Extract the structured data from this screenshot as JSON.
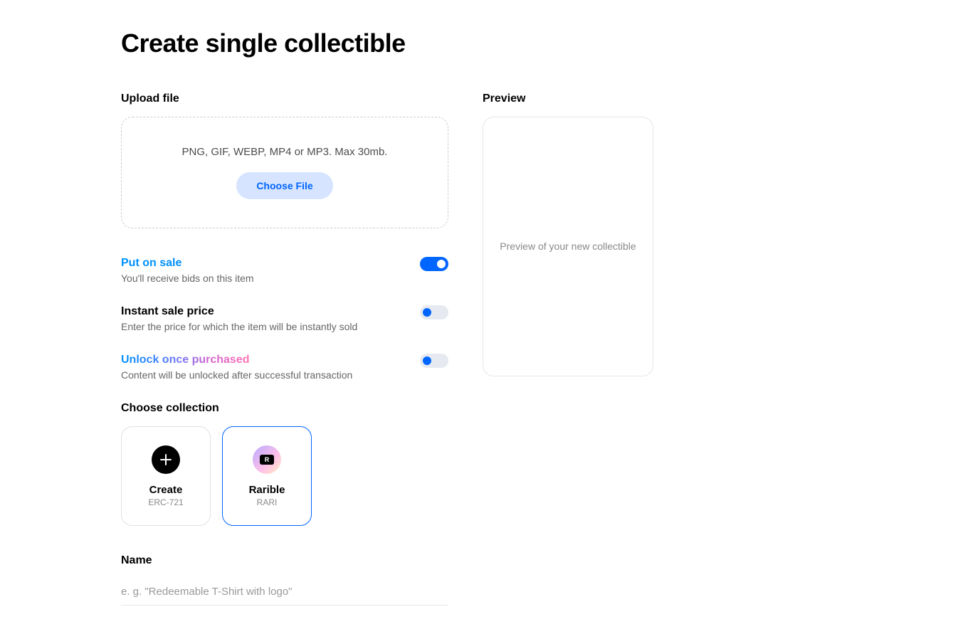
{
  "page_title": "Create single collectible",
  "upload": {
    "label": "Upload file",
    "hint": "PNG, GIF, WEBP, MP4 or MP3. Max 30mb.",
    "button": "Choose File"
  },
  "toggles": {
    "sale": {
      "title": "Put on sale",
      "sub": "You'll receive bids on this item",
      "on": true
    },
    "instant": {
      "title": "Instant sale price",
      "sub": "Enter the price for which the item will be instantly sold",
      "on": false
    },
    "unlock": {
      "title": "Unlock once purchased",
      "sub": "Content will be unlocked after successful transaction",
      "on": false
    }
  },
  "collection": {
    "label": "Choose collection",
    "create": {
      "title": "Create",
      "sub": "ERC-721"
    },
    "rarible": {
      "title": "Rarible",
      "sub": "RARI",
      "badge": "R"
    }
  },
  "name": {
    "label": "Name",
    "placeholder": "e. g. \"Redeemable T-Shirt with logo\""
  },
  "preview": {
    "label": "Preview",
    "text": "Preview of your new collectible"
  }
}
